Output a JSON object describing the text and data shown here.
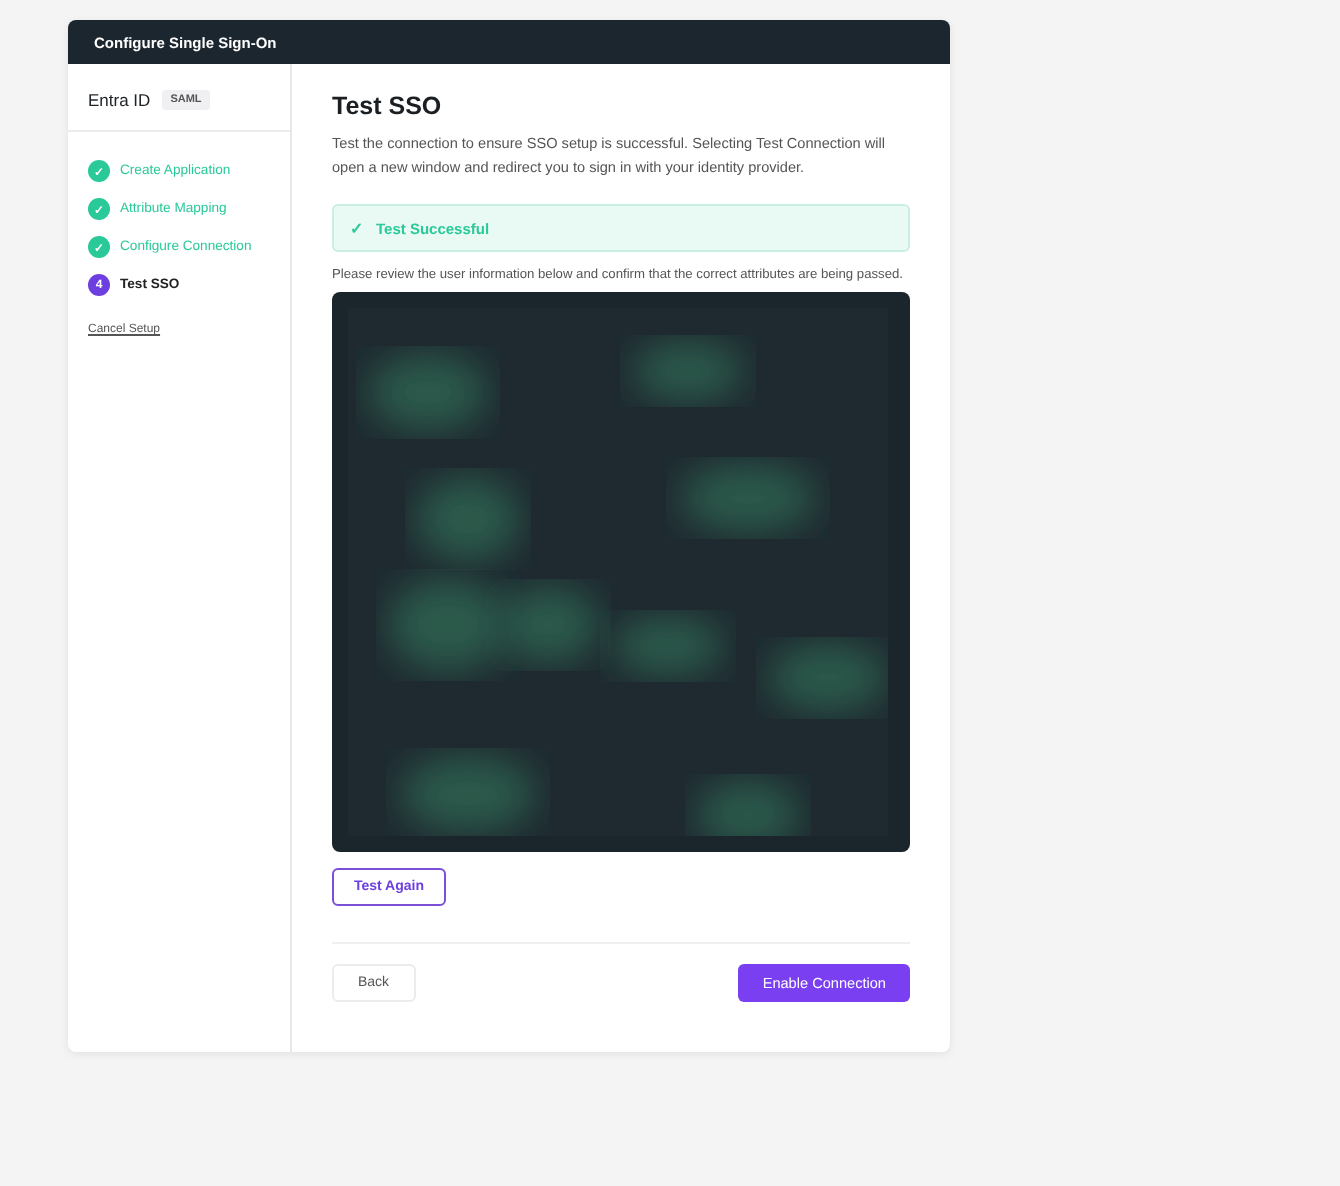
{
  "window": {
    "title": "Configure Single Sign-On"
  },
  "provider": {
    "name": "Entra ID",
    "badge": "SAML"
  },
  "steps": [
    {
      "marker": "✓",
      "label": "Create Application",
      "completed": true,
      "selected": false
    },
    {
      "marker": "✓",
      "label": "Attribute Mapping",
      "completed": true,
      "selected": false
    },
    {
      "marker": "✓",
      "label": "Configure Connection",
      "completed": true,
      "selected": false
    },
    {
      "marker": "4",
      "label": "Test SSO",
      "completed": false,
      "selected": true
    }
  ],
  "cancel_link": "Cancel Setup",
  "heading": "Test SSO",
  "description": "Test the connection to ensure SSO setup is successful. Selecting Test Connection will open a new window and redirect you to sign in with your identity provider.",
  "alert": {
    "icon": "✓",
    "text": "Test Successful"
  },
  "review_note": "Please review the user information below and confirm that the correct attributes are being passed.",
  "buttons": {
    "test_again": "Test Again",
    "back": "Back",
    "enable": "Enable Connection"
  }
}
